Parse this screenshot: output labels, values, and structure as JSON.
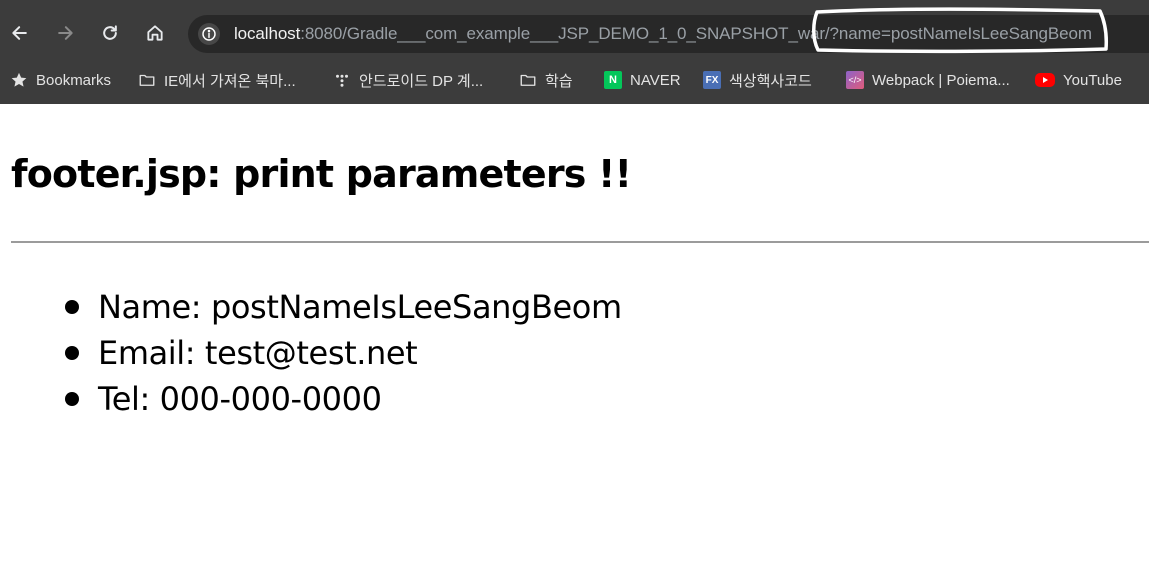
{
  "browser": {
    "url_host": "localhost",
    "url_rest": ":8080/Gradle___com_example___JSP_DEMO_1_0_SNAPSHOT_war/?name=postNameIsLeeSangBeom",
    "bookmarks": [
      {
        "label": "Bookmarks",
        "icon": "star-icon"
      },
      {
        "label": "IE에서 가져온 북마...",
        "icon": "folder-icon"
      },
      {
        "label": "안드로이드 DP 계...",
        "icon": "dots-icon"
      },
      {
        "label": "학습",
        "icon": "folder-icon"
      },
      {
        "label": "NAVER",
        "icon": "naver-favicon",
        "favicon_text": "N"
      },
      {
        "label": "색상핵사코드",
        "icon": "fx-favicon",
        "favicon_text": "FX"
      },
      {
        "label": "Webpack | Poiema...",
        "icon": "webpack-favicon",
        "favicon_text": "</>"
      },
      {
        "label": "YouTube",
        "icon": "youtube-favicon"
      }
    ]
  },
  "page": {
    "title": "footer.jsp: print parameters !!",
    "params": [
      {
        "text": "Name: postNameIsLeeSangBeom"
      },
      {
        "text": "Email: test@test.net"
      },
      {
        "text": "Tel: 000-000-0000"
      }
    ]
  },
  "colors": {
    "chrome_bg": "#3c3c3c",
    "omnibox_bg": "#282828",
    "divider": "#9b9b9b"
  }
}
